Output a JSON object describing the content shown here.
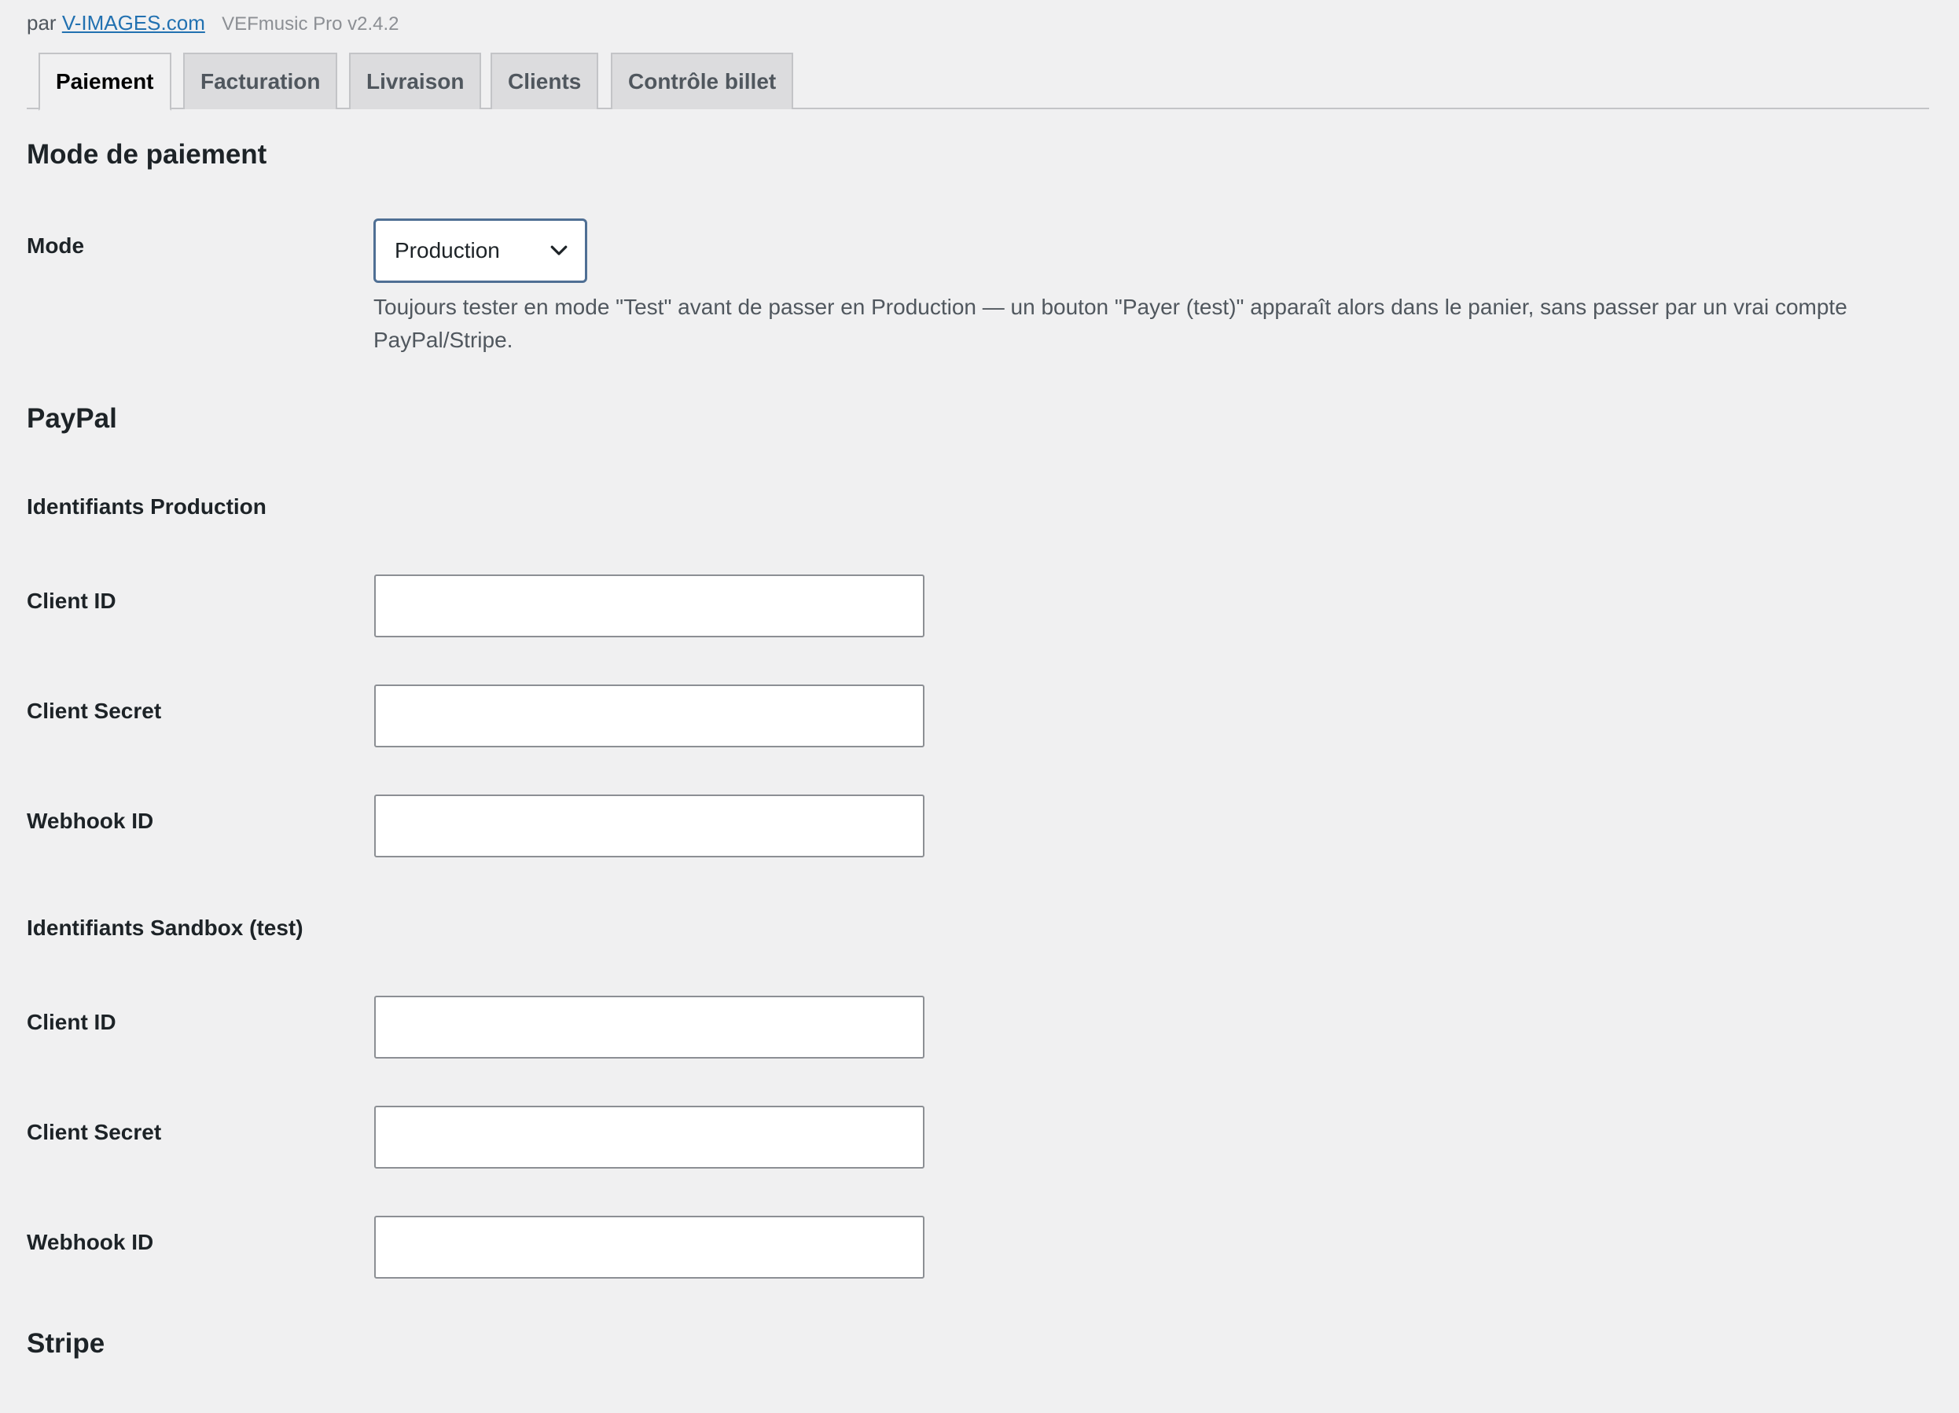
{
  "header": {
    "by_prefix": "par",
    "by_link": "V-IMAGES.com",
    "version": "VEFmusic Pro v2.4.2"
  },
  "tabs": [
    {
      "label": "Paiement",
      "active": true
    },
    {
      "label": "Facturation",
      "active": false
    },
    {
      "label": "Livraison",
      "active": false
    },
    {
      "label": "Clients",
      "active": false
    },
    {
      "label": "Contrôle billet",
      "active": false
    }
  ],
  "payment_mode": {
    "title": "Mode de paiement",
    "mode_label": "Mode",
    "mode_value": "Production",
    "description": "Toujours tester en mode \"Test\" avant de passer en Production — un bouton \"Payer (test)\" apparaît alors dans le panier, sans passer par un vrai compte PayPal/Stripe."
  },
  "paypal": {
    "title": "PayPal",
    "production": {
      "title": "Identifiants Production",
      "client_id_label": "Client ID",
      "client_id_value": "",
      "client_secret_label": "Client Secret",
      "client_secret_value": "",
      "webhook_id_label": "Webhook ID",
      "webhook_id_value": ""
    },
    "sandbox": {
      "title": "Identifiants Sandbox (test)",
      "client_id_label": "Client ID",
      "client_id_value": "",
      "client_secret_label": "Client Secret",
      "client_secret_value": "",
      "webhook_id_label": "Webhook ID",
      "webhook_id_value": ""
    }
  },
  "stripe": {
    "title": "Stripe"
  },
  "colors": {
    "background": "#f0f0f1",
    "link": "#2271b1",
    "select_border": "#4f6f94"
  },
  "icons": {
    "select_arrow": "chevron-down-icon"
  }
}
